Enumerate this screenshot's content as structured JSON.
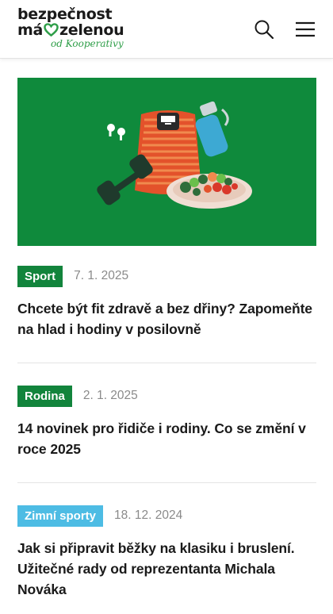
{
  "brand": {
    "line1": "bezpečnost",
    "line2_before": "má",
    "line2_after": "zelenou",
    "sub": "od Kooperativy",
    "heart_color": "#2e9e48"
  },
  "header": {
    "search_icon": "search-icon",
    "menu_icon": "hamburger-menu-icon"
  },
  "colors": {
    "tag_green": "#12843c",
    "tag_blue": "#4dbce4",
    "hero_bg": "#0f8a3c"
  },
  "articles": [
    {
      "tag": "Sport",
      "date": "7. 1. 2025",
      "title": "Chcete být fit zdravě a bez dřiny? Zapomeňte na hlad i hodiny v posilovně"
    },
    {
      "tag": "Rodina",
      "date": "2. 1. 2025",
      "title": "14 novinek pro řidiče i rodiny. Co se změní v roce 2025"
    },
    {
      "tag": "Zimní sporty",
      "date": "18. 12. 2024",
      "title": "Jak si připravit běžky na klasiku i bruslení. Užitečné rady od reprezentanta Michala Nováka"
    }
  ]
}
